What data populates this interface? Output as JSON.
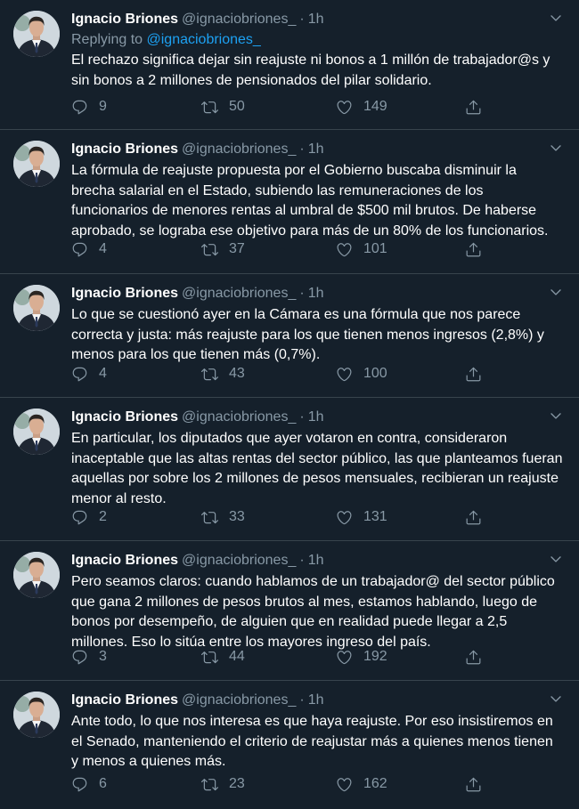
{
  "colors": {
    "background": "#15202b",
    "text": "#ffffff",
    "muted": "#8899a6",
    "link": "#1da1f2",
    "divider": "#38444d"
  },
  "icons": {
    "reply": "reply-icon",
    "retweet": "retweet-icon",
    "like": "heart-icon",
    "share": "share-icon",
    "menu": "chevron-down-icon"
  },
  "tweets": [
    {
      "name": "Ignacio Briones",
      "handle": "@ignaciobriones_",
      "dot": "·",
      "time": "1h",
      "replying_prefix": "Replying to",
      "replying_to": "@ignaciobriones_",
      "text": "El rechazo significa dejar sin reajuste ni bonos a 1 millón de trabajador@s y sin bonos a 2 millones de pensionados del pilar solidario.",
      "replies": "9",
      "retweets": "50",
      "likes": "149"
    },
    {
      "name": "Ignacio Briones",
      "handle": "@ignaciobriones_",
      "dot": "·",
      "time": "1h",
      "text": "La fórmula de reajuste propuesta por el Gobierno buscaba disminuir la brecha salarial en el Estado, subiendo las remuneraciones de los funcionarios de menores rentas al umbral de $500 mil brutos. De haberse aprobado, se lograba ese objetivo para más de un 80% de los funcionarios.",
      "replies": "4",
      "retweets": "37",
      "likes": "101"
    },
    {
      "name": "Ignacio Briones",
      "handle": "@ignaciobriones_",
      "dot": "·",
      "time": "1h",
      "text": "Lo que se cuestionó ayer en la Cámara es una fórmula que nos parece correcta y justa: más reajuste para los que tienen menos ingresos (2,8%) y menos para los que tienen más (0,7%).",
      "replies": "4",
      "retweets": "43",
      "likes": "100"
    },
    {
      "name": "Ignacio Briones",
      "handle": "@ignaciobriones_",
      "dot": "·",
      "time": "1h",
      "text": "En particular, los diputados que ayer votaron en contra, consideraron inaceptable que las altas rentas del sector público, las que planteamos fueran aquellas por sobre los 2 millones de pesos mensuales, recibieran un reajuste menor al resto.",
      "replies": "2",
      "retweets": "33",
      "likes": "131"
    },
    {
      "name": "Ignacio Briones",
      "handle": "@ignaciobriones_",
      "dot": "·",
      "time": "1h",
      "text": "Pero seamos claros: cuando hablamos de un trabajador@ del sector público que gana 2 millones de pesos brutos al mes, estamos hablando, luego de bonos por desempeño, de alguien que en realidad puede llegar a 2,5 millones. Eso lo sitúa entre los mayores ingreso del país.",
      "replies": "3",
      "retweets": "44",
      "likes": "192"
    },
    {
      "name": "Ignacio Briones",
      "handle": "@ignaciobriones_",
      "dot": "·",
      "time": "1h",
      "text": "Ante todo, lo que nos interesa es que haya reajuste. Por eso insistiremos en el Senado, manteniendo el criterio de reajustar más a quienes menos tienen y menos a quienes más.",
      "replies": "6",
      "retweets": "23",
      "likes": "162"
    }
  ]
}
